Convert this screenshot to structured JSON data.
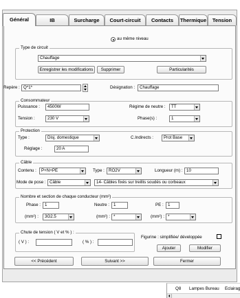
{
  "colors": {
    "frame_background": "#ececec",
    "panel_background": "#fbfbfb",
    "border": "#8c8c8c",
    "input_border": "#7a7a7a"
  },
  "icons": {
    "select_arrow": "chevron-down-icon",
    "spinner_up": "arrow-up-icon",
    "spinner_down": "arrow-down-icon",
    "scroll_left": "arrow-left-icon"
  },
  "tabs": [
    {
      "label": "Général",
      "active": true
    },
    {
      "label": "IB",
      "active": false
    },
    {
      "label": "Surcharge",
      "active": false
    },
    {
      "label": "Court-circuit",
      "active": false
    },
    {
      "label": "Contacts",
      "active": false
    },
    {
      "label": "Thermique",
      "active": false
    },
    {
      "label": "Tension",
      "active": false
    }
  ],
  "level_radio": {
    "label": "au même niveau",
    "checked": true
  },
  "circuit_type": {
    "legend": "Type de circuit",
    "selected": "Chauffage",
    "save_button": "Enregistrer les modifications",
    "delete_button": "Supprimer",
    "particularities_button": "Particularités"
  },
  "repere": {
    "label": "Repère :",
    "value": "Q*1*"
  },
  "designation": {
    "label": "Désignation :",
    "value": "Chauffage"
  },
  "consommateur": {
    "legend": "Consommateur",
    "puissance": {
      "label": "Puissance :",
      "value": "4500W"
    },
    "regime_neutre": {
      "label": "Régime de neutre :",
      "value": "TT"
    },
    "tension": {
      "label": "Tension :",
      "value": "230 V"
    },
    "phases": {
      "label": "Phase(s) :",
      "value": "1"
    }
  },
  "protection": {
    "legend": "Protection",
    "type": {
      "label": "Type :",
      "value": "Disj. domestique"
    },
    "contacts_indirects": {
      "label": "C.Indirects :",
      "value": "Prot Base"
    },
    "reglage": {
      "label": "Réglage :",
      "value": "20 A"
    }
  },
  "cable": {
    "legend": "Câble",
    "contenu": {
      "label": "Contenu :",
      "value": "P+N+PE"
    },
    "type": {
      "label": "Type :",
      "value": "RO2V"
    },
    "longueur": {
      "label": "Longueur (m) :",
      "value": "10"
    },
    "mode_pose": {
      "label": "Mode de pose :",
      "value": "Câble"
    },
    "pose_reference": "14- Câbles fixés sur treillis soudés ou corbeaux"
  },
  "conducteurs": {
    "legend": "Nombre et section de chaque conducteur (mm²)",
    "phase": {
      "label": "Phase :",
      "count": "1",
      "section_label": "(mm²) :",
      "section": "3G2.5"
    },
    "neutre": {
      "label": "Neutre :",
      "count": "1",
      "section_label": "(mm²) :",
      "section": "*"
    },
    "pe": {
      "label": "PE :",
      "count": "1",
      "section_label": "(mm²) :",
      "section": "*"
    }
  },
  "chute_tension": {
    "legend": "Chute de tension ( V et % ) :",
    "volts": {
      "label": "( V ) :",
      "value": ""
    },
    "percent": {
      "label": "( % ) :",
      "value": ""
    }
  },
  "figurine": {
    "label": "Figurine : simplifiée/ développée",
    "checked": false
  },
  "actions": {
    "add_button": "Ajouter",
    "modify_button": "Modifier"
  },
  "navigation": {
    "previous_button": "<< Précédent",
    "next_button": "Suivant >>",
    "close_button": "Fermer"
  },
  "background_table": {
    "row": [
      "Q8",
      "Lampes Bureau",
      "Eclairag"
    ]
  }
}
